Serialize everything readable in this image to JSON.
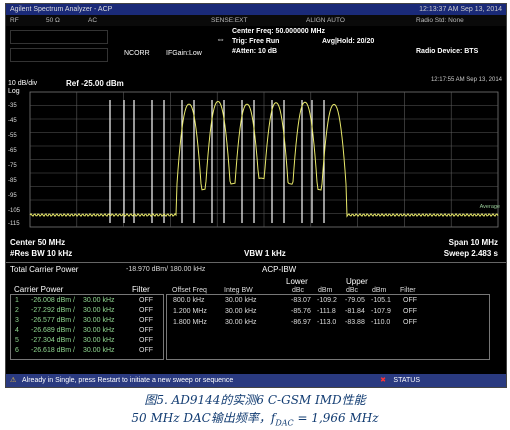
{
  "window": {
    "title": "Agilent Spectrum Analyzer - ACP"
  },
  "status_row": {
    "rf": "RF",
    "impedance": "50 Ω",
    "ac": "AC",
    "sense": "SENSE:EXT",
    "align": "ALIGN AUTO",
    "datetime": "12:13:37 AM Sep 13, 2014",
    "radio_std": "Radio Std: None",
    "radio_device": "Radio Device: BTS"
  },
  "header": {
    "center_freq": "Center Freq: 50.000000 MHz",
    "trig": "Trig: Free Run",
    "atten": "#Atten: 10 dB",
    "avg_hold": "Avg|Hold: 20/20",
    "ncorr": "NCORR",
    "ifgain": "IFGain:Low"
  },
  "plot": {
    "scale": "10 dB/div",
    "log": "Log",
    "ref": "Ref -25.00 dBm",
    "y_ticks": [
      "-35",
      "-45",
      "-55",
      "-65",
      "-75",
      "-85",
      "-95",
      "-105",
      "-115"
    ],
    "timestamp": "12:17:55 AM Sep 13, 2014",
    "trace_label": "Average"
  },
  "axis": {
    "center": "Center 50 MHz",
    "res_bw": "#Res BW 10 kHz",
    "vbw": "VBW 1 kHz",
    "span": "Span 10 MHz",
    "sweep": "Sweep 2.483 s"
  },
  "results": {
    "total_power_label": "Total Carrier Power",
    "total_power_value": "-18.970 dBm/ 180.00 kHz",
    "mode": "ACP-IBW",
    "carrier_headers": [
      "Carrier Power",
      "Filter"
    ],
    "carriers": [
      {
        "n": "1",
        "power": "-26.008 dBm /",
        "bw": "30.00 kHz",
        "filter": "OFF"
      },
      {
        "n": "2",
        "power": "-27.292 dBm /",
        "bw": "30.00 kHz",
        "filter": "OFF"
      },
      {
        "n": "3",
        "power": "-26.577 dBm /",
        "bw": "30.00 kHz",
        "filter": "OFF"
      },
      {
        "n": "4",
        "power": "-26.689 dBm /",
        "bw": "30.00 kHz",
        "filter": "OFF"
      },
      {
        "n": "5",
        "power": "-27.304 dBm /",
        "bw": "30.00 kHz",
        "filter": "OFF"
      },
      {
        "n": "6",
        "power": "-26.618 dBm /",
        "bw": "30.00 kHz",
        "filter": "OFF"
      }
    ],
    "group_lower": "Lower",
    "group_upper": "Upper",
    "acp_headers": [
      "Offset Freq",
      "Integ BW",
      "dBc",
      "dBm",
      "dBc",
      "dBm",
      "Filter"
    ],
    "acp_rows": [
      [
        "800.0 kHz",
        "30.00 kHz",
        "-83.07",
        "-109.2",
        "-79.05",
        "-105.1",
        "OFF"
      ],
      [
        "1.200 MHz",
        "30.00 kHz",
        "-85.76",
        "-111.8",
        "-81.84",
        "-107.9",
        "OFF"
      ],
      [
        "1.800 MHz",
        "30.00 kHz",
        "-86.97",
        "-113.0",
        "-83.88",
        "-110.0",
        "OFF"
      ]
    ]
  },
  "message_bar": {
    "text": "Already in Single, press Restart to initiate a new sweep or sequence",
    "status": "STATUS"
  },
  "caption": {
    "line1": "图5. AD9144的实测6 C-GSM IMD性能",
    "line2": "50 MHz DAC输出频率，f",
    "line2_sub": "DAC",
    "line2_end": " = 1,966 MHz"
  },
  "colors": {
    "trace": "#e8e86a",
    "grid": "#5a5a5a",
    "marker_lines": "#ffffff",
    "titlebar": "#1a2a78",
    "caption": "#123c72"
  }
}
